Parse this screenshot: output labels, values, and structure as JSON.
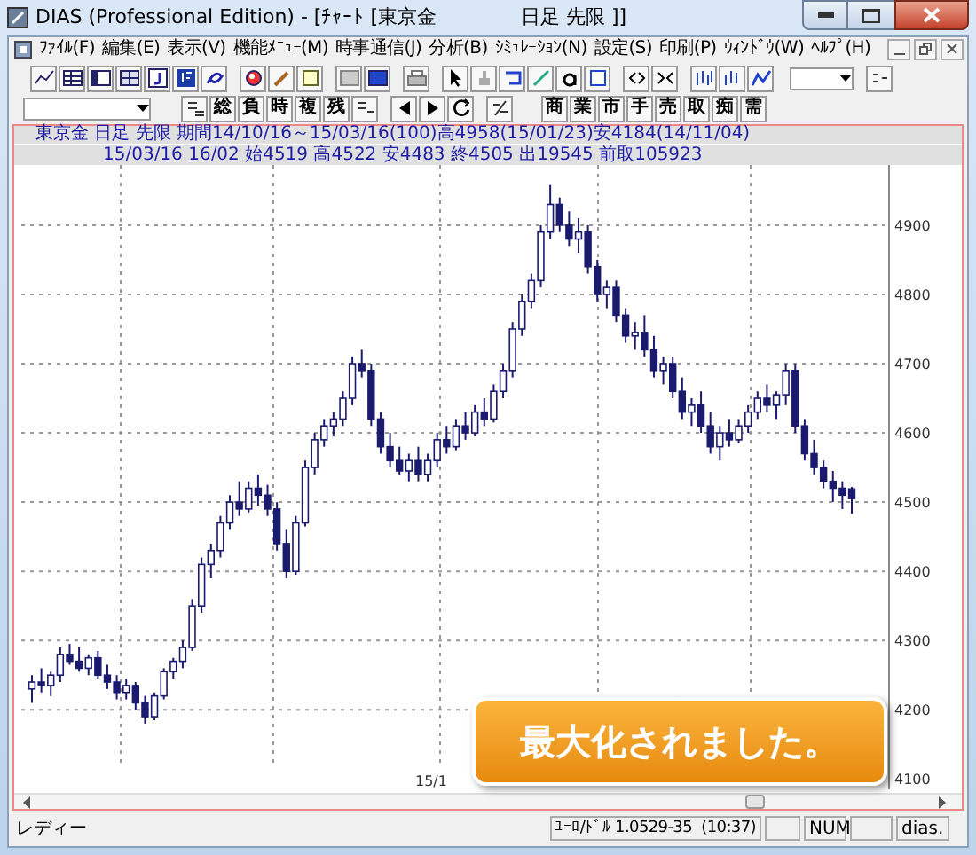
{
  "window": {
    "title": "DIAS (Professional Edition) - [ﾁｬｰﾄ [東京金　　　　 日足 先限 ]]"
  },
  "menu": [
    "ﾌｧｲﾙ(F)",
    "編集(E)",
    "表示(V)",
    "機能ﾒﾆｭｰ(M)",
    "時事通信(J)",
    "分析(B)",
    "ｼﾐｭﾚｰｼｮﾝ(N)",
    "設定(S)",
    "印刷(P)",
    "ｳｨﾝﾄﾞｳ(W)",
    "ﾍﾙﾌﾟ(H)"
  ],
  "toolbar2": {
    "left_buttons": [
      "総",
      "負",
      "時",
      "複",
      "残"
    ],
    "right_buttons": [
      "商",
      "業",
      "市",
      "手",
      "売",
      "取",
      "痴",
      "需"
    ]
  },
  "chart": {
    "header_lines": [
      "東京金 日足 先限 期間14/10/16～15/03/16(100)高4958(15/01/23)安4184(14/11/04)",
      "15/03/16 16/02 始4519 高4522 安4483 終4505 出19545 前取105923"
    ],
    "x_axis_label": "15/1",
    "chart_data": {
      "type": "candlestick",
      "grid": true,
      "ylim": [
        4085,
        4987
      ],
      "yticks": [
        {
          "value": 4900,
          "label": "4900"
        },
        {
          "value": 4800,
          "label": "4800"
        },
        {
          "value": 4700,
          "label": "4700"
        },
        {
          "value": 4600,
          "label": "4600"
        },
        {
          "value": 4500,
          "label": "4500"
        },
        {
          "value": 4400,
          "label": "4400"
        },
        {
          "value": 4300,
          "label": "4300"
        },
        {
          "value": 4200,
          "label": "4200"
        },
        {
          "value": 4100,
          "label": "4100"
        }
      ],
      "ohlc": [
        [
          4230,
          4250,
          4210,
          4240
        ],
        [
          4240,
          4260,
          4225,
          4235
        ],
        [
          4235,
          4255,
          4220,
          4250
        ],
        [
          4250,
          4290,
          4240,
          4280
        ],
        [
          4280,
          4295,
          4265,
          4270
        ],
        [
          4270,
          4290,
          4255,
          4260
        ],
        [
          4260,
          4280,
          4250,
          4275
        ],
        [
          4275,
          4285,
          4245,
          4250
        ],
        [
          4250,
          4265,
          4230,
          4240
        ],
        [
          4240,
          4250,
          4215,
          4225
        ],
        [
          4225,
          4245,
          4215,
          4235
        ],
        [
          4235,
          4240,
          4200,
          4210
        ],
        [
          4210,
          4220,
          4180,
          4190
        ],
        [
          4190,
          4225,
          4185,
          4220
        ],
        [
          4220,
          4260,
          4215,
          4255
        ],
        [
          4255,
          4275,
          4245,
          4270
        ],
        [
          4270,
          4300,
          4260,
          4290
        ],
        [
          4290,
          4360,
          4285,
          4350
        ],
        [
          4350,
          4420,
          4340,
          4410
        ],
        [
          4410,
          4440,
          4390,
          4430
        ],
        [
          4430,
          4480,
          4420,
          4470
        ],
        [
          4470,
          4510,
          4460,
          4500
        ],
        [
          4500,
          4530,
          4480,
          4490
        ],
        [
          4490,
          4530,
          4485,
          4520
        ],
        [
          4520,
          4540,
          4495,
          4510
        ],
        [
          4510,
          4525,
          4480,
          4490
        ],
        [
          4490,
          4500,
          4430,
          4440
        ],
        [
          4440,
          4460,
          4390,
          4400
        ],
        [
          4400,
          4480,
          4395,
          4470
        ],
        [
          4470,
          4560,
          4465,
          4550
        ],
        [
          4550,
          4600,
          4540,
          4590
        ],
        [
          4590,
          4620,
          4580,
          4610
        ],
        [
          4610,
          4630,
          4595,
          4620
        ],
        [
          4620,
          4660,
          4610,
          4650
        ],
        [
          4650,
          4710,
          4640,
          4700
        ],
        [
          4700,
          4720,
          4680,
          4690
        ],
        [
          4690,
          4700,
          4610,
          4620
        ],
        [
          4620,
          4630,
          4570,
          4580
        ],
        [
          4580,
          4600,
          4550,
          4560
        ],
        [
          4560,
          4580,
          4540,
          4545
        ],
        [
          4545,
          4570,
          4530,
          4560
        ],
        [
          4560,
          4580,
          4530,
          4540
        ],
        [
          4540,
          4570,
          4530,
          4560
        ],
        [
          4560,
          4600,
          4550,
          4590
        ],
        [
          4590,
          4610,
          4570,
          4580
        ],
        [
          4580,
          4620,
          4575,
          4610
        ],
        [
          4610,
          4630,
          4590,
          4600
        ],
        [
          4600,
          4640,
          4595,
          4630
        ],
        [
          4630,
          4650,
          4610,
          4620
        ],
        [
          4620,
          4670,
          4615,
          4660
        ],
        [
          4660,
          4700,
          4650,
          4690
        ],
        [
          4690,
          4760,
          4680,
          4750
        ],
        [
          4750,
          4800,
          4740,
          4790
        ],
        [
          4790,
          4830,
          4780,
          4820
        ],
        [
          4820,
          4900,
          4810,
          4890
        ],
        [
          4890,
          4958,
          4880,
          4930
        ],
        [
          4930,
          4940,
          4890,
          4900
        ],
        [
          4900,
          4920,
          4870,
          4880
        ],
        [
          4880,
          4910,
          4860,
          4890
        ],
        [
          4890,
          4900,
          4830,
          4840
        ],
        [
          4840,
          4850,
          4790,
          4800
        ],
        [
          4800,
          4820,
          4780,
          4810
        ],
        [
          4810,
          4820,
          4760,
          4770
        ],
        [
          4770,
          4780,
          4730,
          4740
        ],
        [
          4740,
          4760,
          4720,
          4745
        ],
        [
          4745,
          4770,
          4710,
          4720
        ],
        [
          4720,
          4740,
          4680,
          4690
        ],
        [
          4690,
          4710,
          4670,
          4700
        ],
        [
          4700,
          4710,
          4650,
          4660
        ],
        [
          4660,
          4680,
          4620,
          4630
        ],
        [
          4630,
          4650,
          4610,
          4640
        ],
        [
          4640,
          4660,
          4600,
          4610
        ],
        [
          4610,
          4630,
          4570,
          4580
        ],
        [
          4580,
          4610,
          4560,
          4600
        ],
        [
          4600,
          4620,
          4580,
          4590
        ],
        [
          4590,
          4620,
          4585,
          4610
        ],
        [
          4610,
          4640,
          4600,
          4630
        ],
        [
          4630,
          4660,
          4620,
          4650
        ],
        [
          4650,
          4670,
          4630,
          4640
        ],
        [
          4640,
          4660,
          4620,
          4655
        ],
        [
          4655,
          4700,
          4640,
          4690
        ],
        [
          4690,
          4700,
          4600,
          4610
        ],
        [
          4610,
          4620,
          4560,
          4570
        ],
        [
          4570,
          4590,
          4540,
          4550
        ],
        [
          4550,
          4560,
          4520,
          4530
        ],
        [
          4530,
          4545,
          4500,
          4520
        ],
        [
          4520,
          4530,
          4490,
          4510
        ],
        [
          4519,
          4522,
          4483,
          4505
        ]
      ]
    }
  },
  "toast": "最大化されました。",
  "status_bar": {
    "message": "レディー",
    "rate": "ﾕｰﾛ/ﾄﾞﾙ 1.0529-35  (10:37)",
    "num": "NUM",
    "server": "dias."
  }
}
